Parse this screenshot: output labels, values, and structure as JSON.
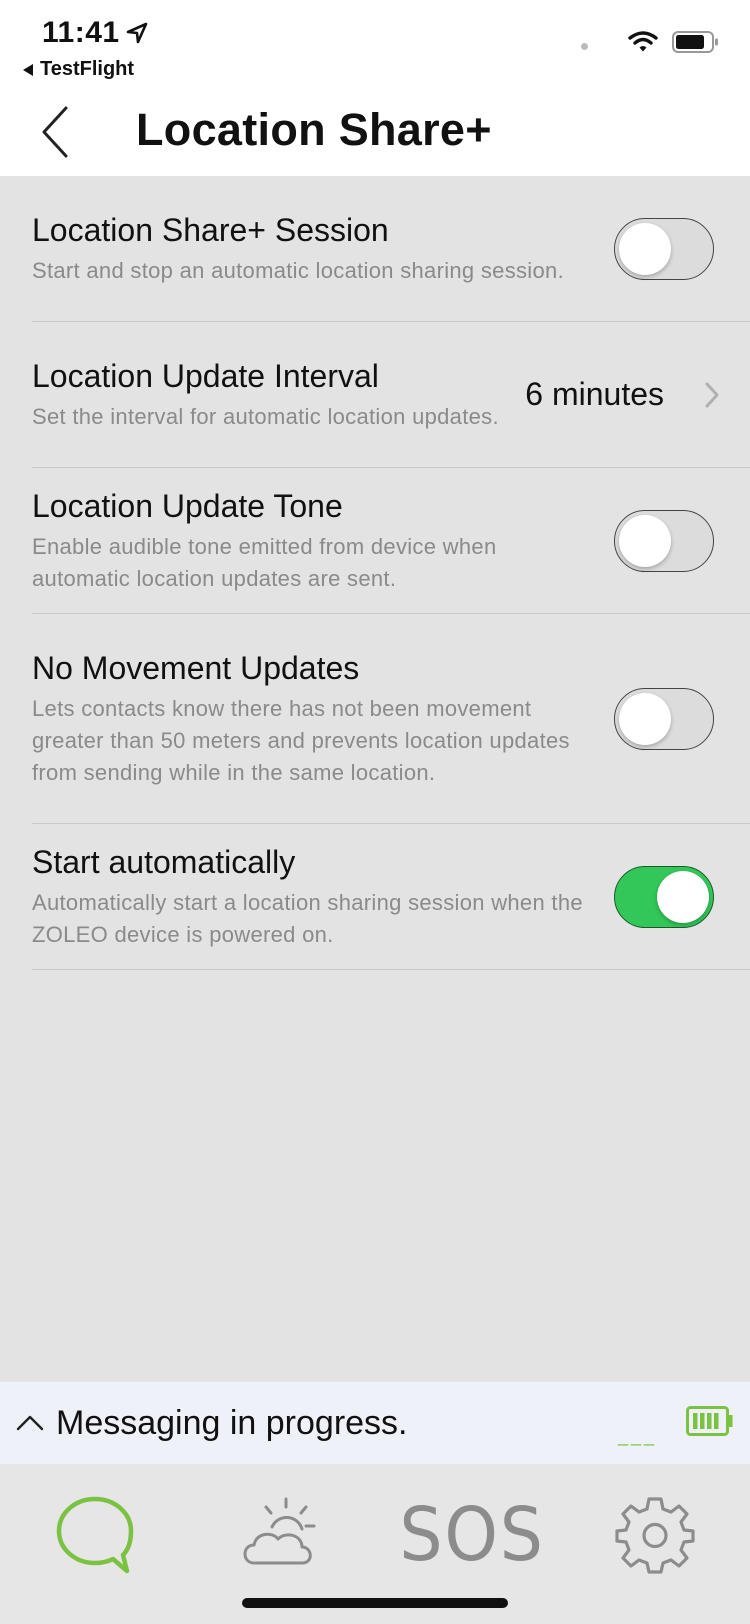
{
  "status_bar": {
    "time": "11:41",
    "back_app": "TestFlight"
  },
  "nav": {
    "title": "Location Share+"
  },
  "settings": [
    {
      "title": "Location Share+ Session",
      "description": "Start and stop an automatic location sharing session.",
      "toggle_on": false
    },
    {
      "title": "Location Update Interval",
      "description": "Set the interval for automatic location updates.",
      "value": "6 minutes"
    },
    {
      "title": "Location Update Tone",
      "description": "Enable audible tone emitted from device when automatic location updates are sent.",
      "toggle_on": false
    },
    {
      "title": "No Movement Updates",
      "description": "Lets contacts know there has not been movement greater than 50 meters and prevents location updates from sending while in the same location.",
      "toggle_on": false
    },
    {
      "title": "Start automatically",
      "description": "Automatically start a location sharing session when the ZOLEO device is powered on.",
      "toggle_on": true
    }
  ],
  "message_bar": {
    "text": "Messaging in progress.",
    "signal": "___"
  },
  "tabs": [
    {
      "name": "messages",
      "icon": "chat-bubble-icon",
      "active": true
    },
    {
      "name": "weather",
      "icon": "weather-icon",
      "active": false
    },
    {
      "name": "sos",
      "label": "SOS",
      "active": false
    },
    {
      "name": "settings",
      "icon": "gear-icon",
      "active": false
    }
  ],
  "colors": {
    "toggle_on": "#33c759",
    "tab_active": "#7bc142",
    "tab_inactive": "#8c8c8c",
    "background": "#e3e3e3"
  }
}
